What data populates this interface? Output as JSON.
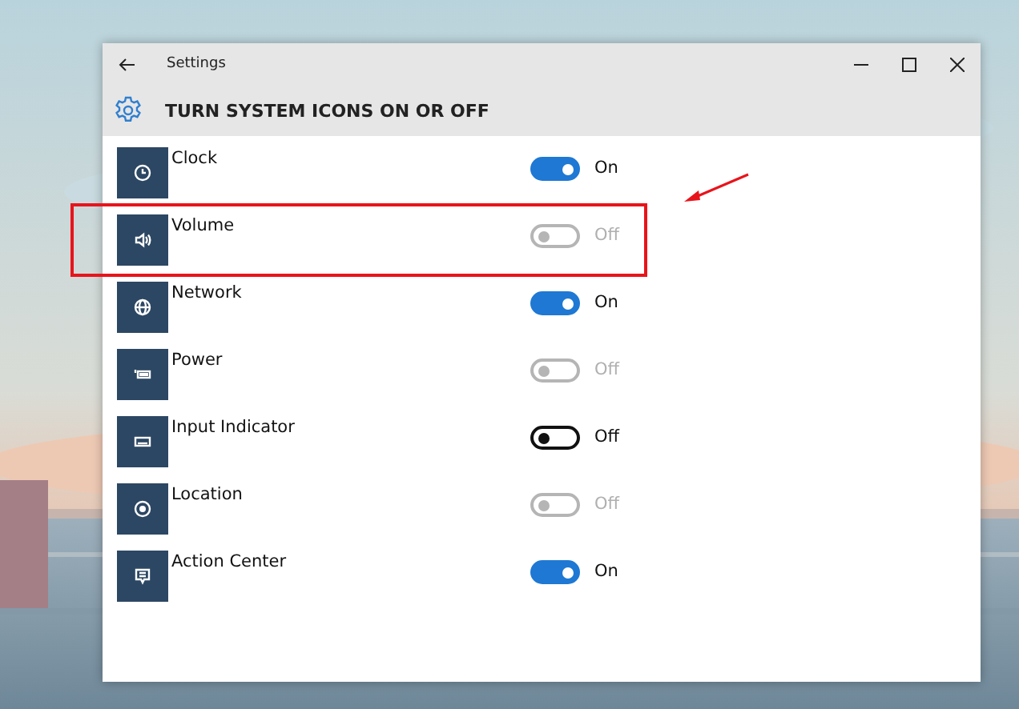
{
  "window": {
    "title": "Settings"
  },
  "header": {
    "title": "TURN SYSTEM ICONS ON OR OFF"
  },
  "items": [
    {
      "label": "Clock",
      "on": true,
      "disabled": false,
      "status": "On",
      "highlighted": false
    },
    {
      "label": "Volume",
      "on": false,
      "disabled": true,
      "status": "Off",
      "highlighted": true
    },
    {
      "label": "Network",
      "on": true,
      "disabled": false,
      "status": "On",
      "highlighted": false
    },
    {
      "label": "Power",
      "on": false,
      "disabled": true,
      "status": "Off",
      "highlighted": false
    },
    {
      "label": "Input Indicator",
      "on": false,
      "disabled": false,
      "status": "Off",
      "highlighted": false
    },
    {
      "label": "Location",
      "on": false,
      "disabled": true,
      "status": "Off",
      "highlighted": false
    },
    {
      "label": "Action Center",
      "on": true,
      "disabled": false,
      "status": "On",
      "highlighted": false
    }
  ]
}
